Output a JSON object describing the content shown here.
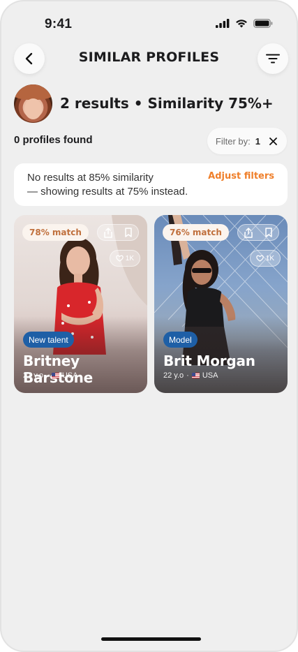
{
  "status_bar": {
    "time": "9:41",
    "icons": [
      "cellular-icon",
      "wifi-icon",
      "battery-icon"
    ]
  },
  "header": {
    "title": "SIMILAR PROFILES",
    "back_icon": "chevron-left-icon",
    "filter_icon": "filter-lines-icon"
  },
  "summary": {
    "headline": "2 results • Similarity 75%+",
    "profiles_found": "0 profiles found"
  },
  "filter_chip": {
    "label": "Filter by:",
    "count": "1",
    "clear_icon": "close-icon"
  },
  "notice": {
    "line1": "No results at 85% similarity",
    "line2": "— showing results at 75% instead.",
    "action": "Adjust filters"
  },
  "cards": [
    {
      "match": "78% match",
      "likes": "1K",
      "tag": "New talent",
      "name": "Britney Barstone",
      "age": "22 y.o",
      "separator": "·",
      "country": "USA"
    },
    {
      "match": "76% match",
      "likes": "1K",
      "tag": "Model",
      "name": "Brit Morgan",
      "age": "22 y.o",
      "separator": "·",
      "country": "USA"
    }
  ],
  "colors": {
    "accent": "#ef7f2a",
    "tag_blue": "#1e5fa6",
    "background": "#efefef",
    "match_text": "#c0703d"
  }
}
